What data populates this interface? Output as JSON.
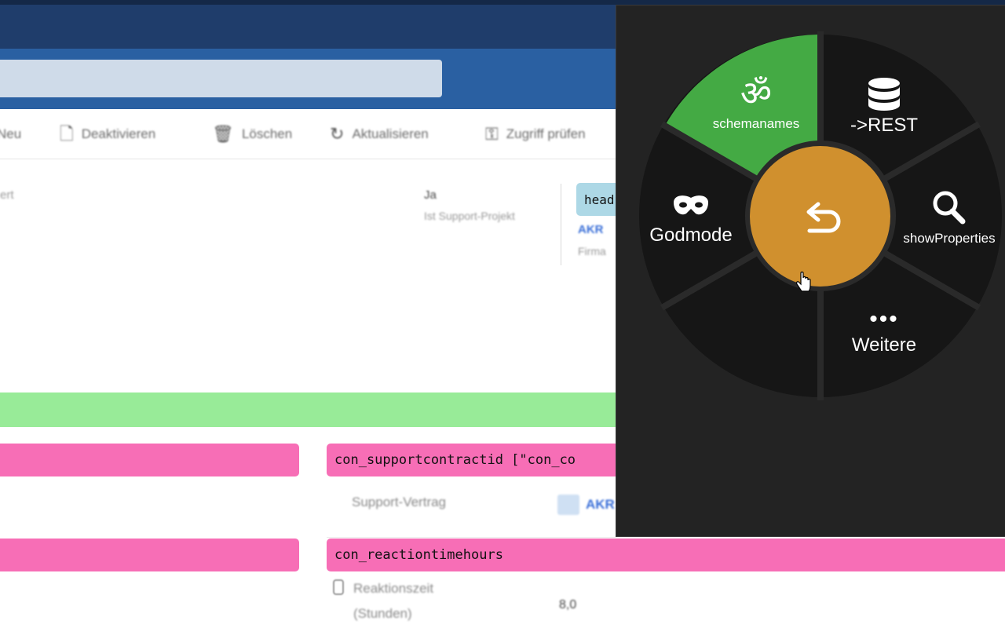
{
  "commandbar": {
    "new_label": "Neu",
    "deactivate_label": "Deaktivieren",
    "delete_label": "Löschen",
    "refresh_label": "Aktualisieren",
    "access_label": "Zugriff prüfen"
  },
  "header": {
    "left_text": "ert",
    "field_value": "Ja",
    "field_label": "Ist Support-Projekt",
    "chip_text": "head",
    "link_text": "AKR",
    "sub_text": "Firma"
  },
  "fields": {
    "support_contract_tag": "con_supportcontractid [\"con_co",
    "support_contract_label": "Support-Vertrag",
    "support_contract_value": "AKR",
    "reaction_tag": "con_reactiontimehours",
    "reaction_label_line1": "Reaktionszeit",
    "reaction_label_line2": "(Stunden)",
    "reaction_value": "8,0"
  },
  "radial_menu": {
    "items": [
      {
        "id": "schemanames",
        "label": "schemanames",
        "icon": "om-icon",
        "glyph": "ॐ",
        "color": "#44aa44"
      },
      {
        "id": "rest",
        "label": "->REST",
        "icon": "database-icon"
      },
      {
        "id": "godmode",
        "label": "Godmode",
        "icon": "mask-icon"
      },
      {
        "id": "showproperties",
        "label": "showProperties",
        "icon": "search-icon"
      },
      {
        "id": "more",
        "label": "Weitere",
        "icon": "more-icon",
        "glyph": "•••"
      }
    ],
    "center": {
      "icon": "back-arrow-icon",
      "color": "#d0902e"
    },
    "segment_color": "#161616",
    "panel_color": "#232323"
  }
}
